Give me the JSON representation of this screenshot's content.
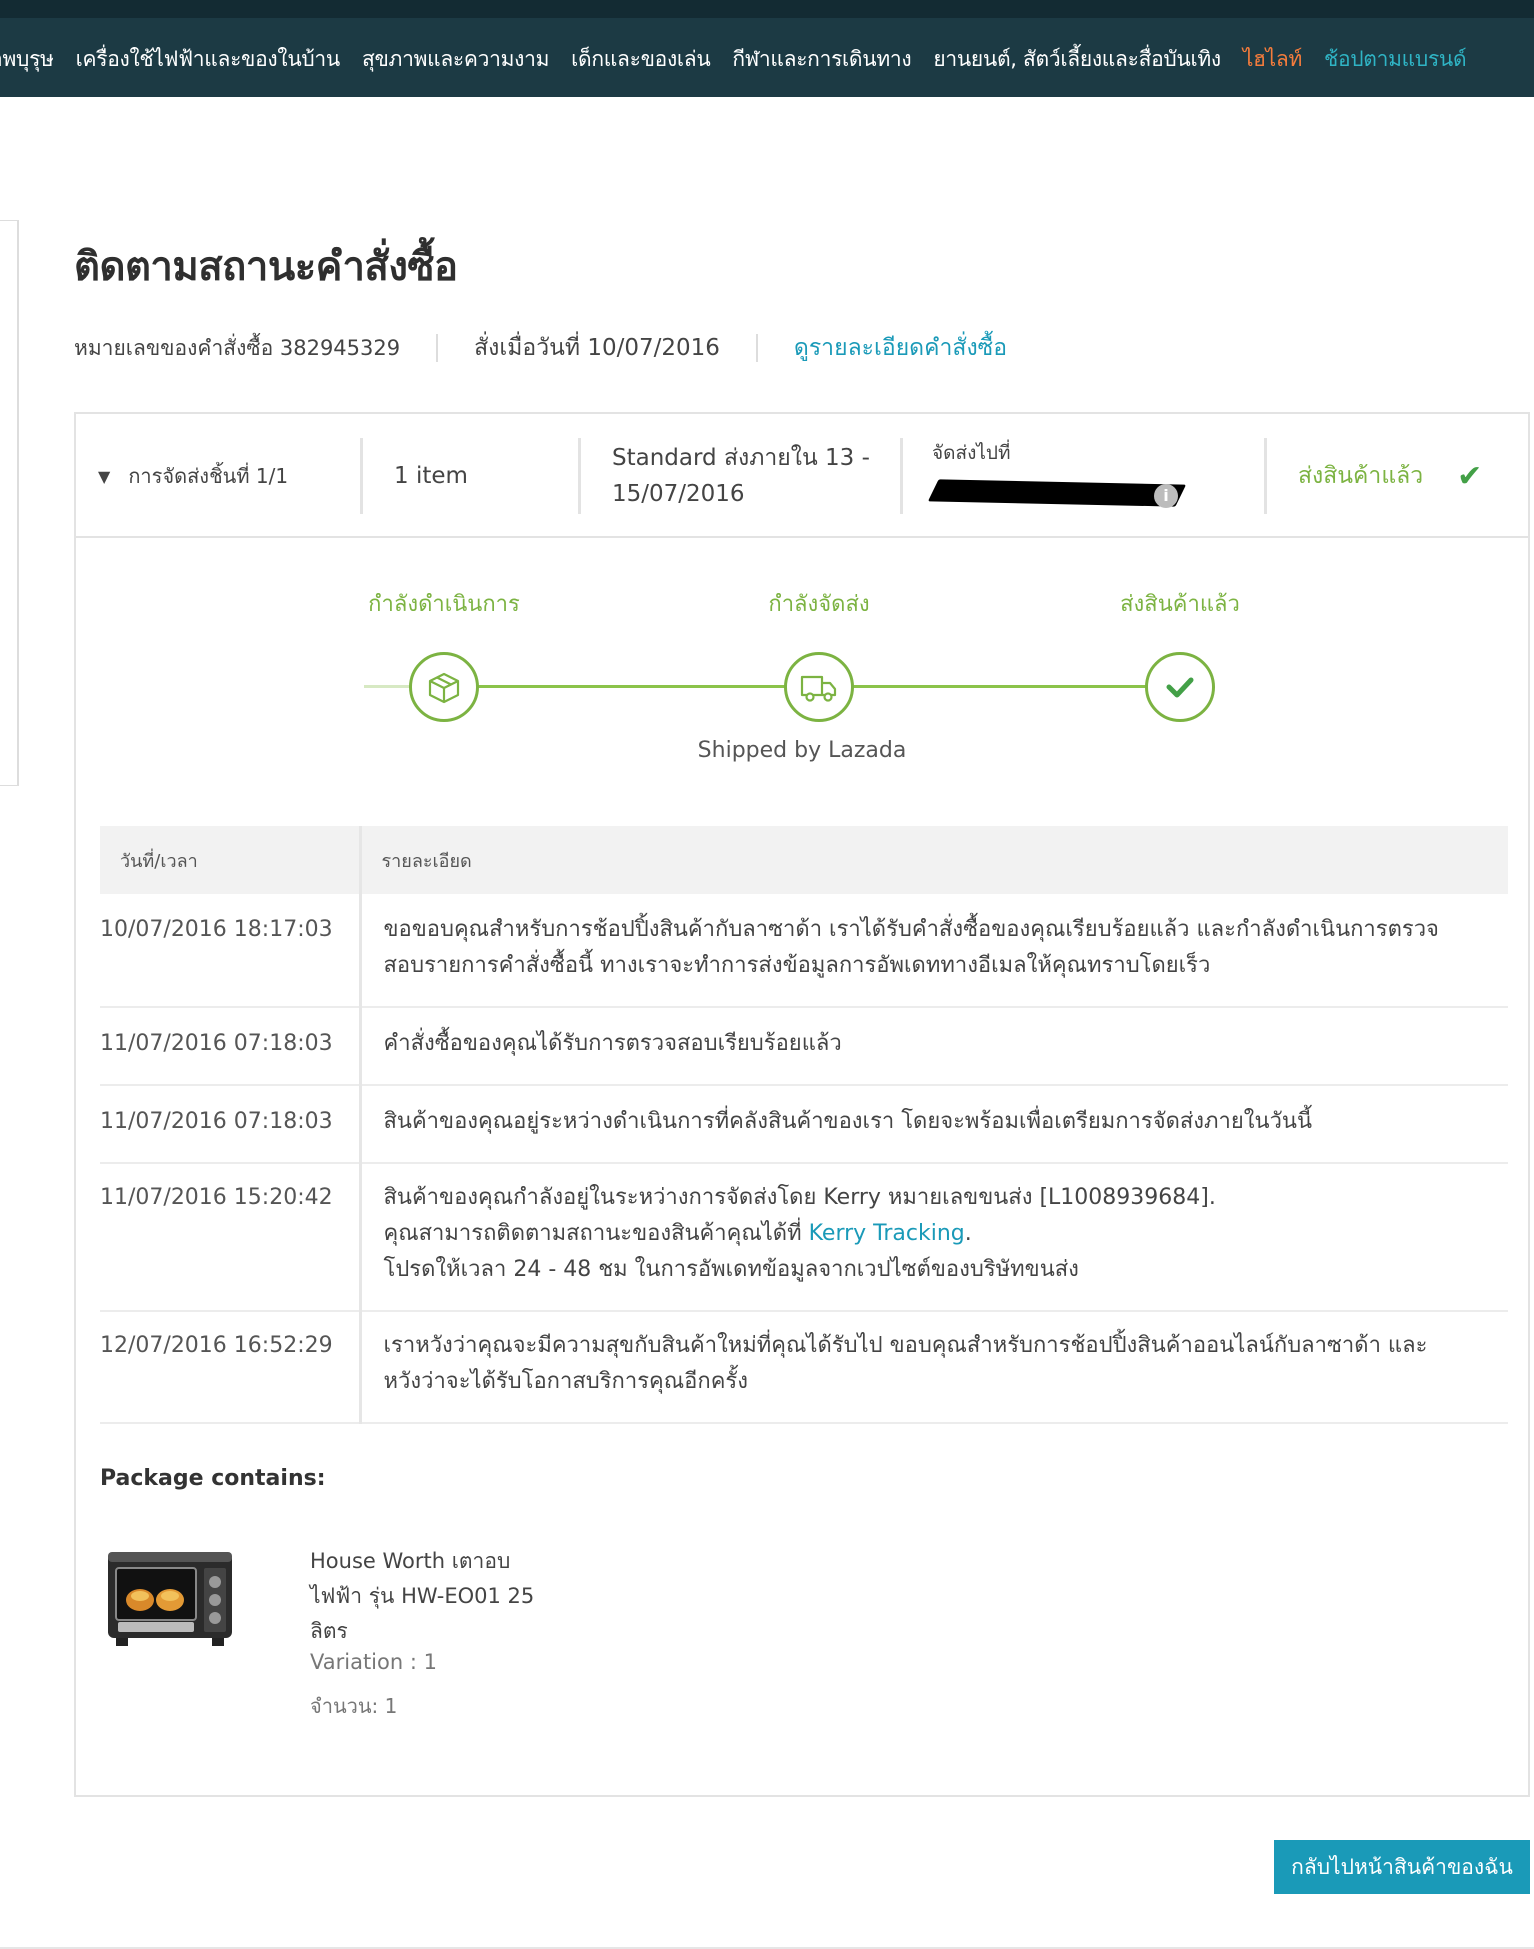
{
  "nav": {
    "items": [
      "าพบุรุษ",
      "เครื่องใช้ไฟฟ้าและของในบ้าน",
      "สุขภาพและความงาม",
      "เด็กและของเล่น",
      "กีฬาและการเดินทาง",
      "ยานยนต์, สัตว์เลี้ยงและสื่อบันเทิง",
      "ไฮไลท์",
      "ช้อปตามแบรนด์"
    ]
  },
  "page": {
    "title": "ติดตามสถานะคำสั่งซื้อ",
    "order_number": "หมายเลขของคำสั่งซื้อ 382945329",
    "order_date": "สั่งเมื่อวันที่ 10/07/2016",
    "order_details_link": "ดูรายละเอียดคำสั่งซื้อ"
  },
  "shipment": {
    "label": "การจัดส่งชิ้นที่ 1/1",
    "items": "1 item",
    "delivery_line1": "Standard ส่งภายใน 13 -",
    "delivery_line2": "15/07/2016",
    "ship_to_label": "จัดส่งไปที่",
    "status": "ส่งสินค้าแล้ว",
    "status_color": "#7cb342"
  },
  "progress": {
    "steps": [
      {
        "label": "กำลังดำเนินการ",
        "icon": "box-icon"
      },
      {
        "label": "กำลังจัดส่ง",
        "icon": "truck-icon"
      },
      {
        "label": "ส่งสินค้าแล้ว",
        "icon": "check-icon"
      }
    ],
    "shipped_by": "Shipped by Lazada"
  },
  "history": {
    "headers": [
      "วันที่/เวลา",
      "รายละเอียด"
    ],
    "rows": [
      {
        "datetime": "10/07/2016 18:17:03",
        "line1": "ขอขอบคุณสำหรับการช้อปปิ้งสินค้ากับลาซาด้า เราได้รับคำสั่งซื้อของคุณเรียบร้อยแล้ว และกำลังดำเนินการตรวจ",
        "line2": "สอบรายการคำสั่งซื้อนี้ ทางเราจะทำการส่งข้อมูลการอัพเดททางอีเมลให้คุณทราบโดยเร็ว"
      },
      {
        "datetime": "11/07/2016 07:18:03",
        "line1": "คำสั่งซื้อของคุณได้รับการตรวจสอบเรียบร้อยแล้ว"
      },
      {
        "datetime": "11/07/2016 07:18:03",
        "line1": "สินค้าของคุณอยู่ระหว่างดำเนินการที่คลังสินค้าของเรา โดยจะพร้อมเพื่อเตรียมการจัดส่งภายในวันนี้"
      },
      {
        "datetime": "11/07/2016 15:20:42",
        "line1": "สินค้าของคุณกำลังอยู่ในระหว่างการจัดส่งโดย Kerry หมายเลขขนส่ง [L1008939684].",
        "line2_prefix": "คุณสามารถติดตามสถานะของสินค้าคุณได้ที่ ",
        "line2_link": "Kerry Tracking",
        "line2_suffix": ".",
        "line3": "โปรดให้เวลา 24 - 48 ชม ในการอัพเดทข้อมูลจากเวปไซต์ของบริษัทขนส่ง"
      },
      {
        "datetime": "12/07/2016 16:52:29",
        "line1": "เราหวังว่าคุณจะมีความสุขกับสินค้าใหม่ที่คุณได้รับไป ขอบคุณสำหรับการช้อปปิ้งสินค้าออนไลน์กับลาซาด้า และ",
        "line2": "หวังว่าจะได้รับโอกาสบริการคุณอีกครั้ง"
      }
    ]
  },
  "package": {
    "title": "Package contains:",
    "product_name_line1": "House Worth เตาอบ",
    "product_name_line2": "ไฟฟ้า รุ่น HW-EO01 25",
    "product_name_line3": "ลิตร",
    "variation": "Variation : 1",
    "quantity": "จำนวน: 1",
    "image_icon": "toaster-oven-image"
  },
  "actions": {
    "back_button": "กลับไปหน้าสินค้าของฉัน"
  },
  "colors": {
    "nav_bg": "#1c3a44",
    "accent_teal": "#1a9ab8",
    "accent_green": "#7cb342",
    "highlight_orange": "#f57c3c"
  }
}
